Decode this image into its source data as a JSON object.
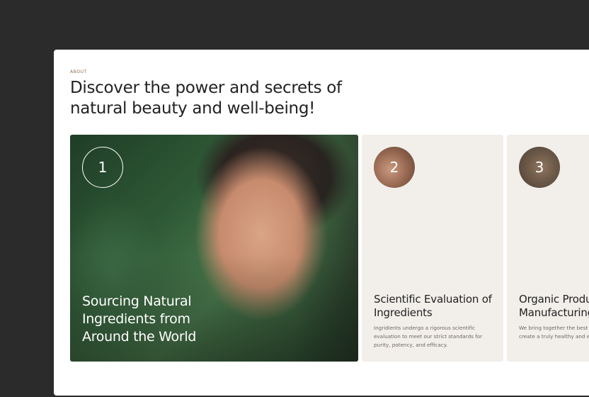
{
  "section": {
    "eyebrow": "ABOUT",
    "headline": "Discover the power and secrets of natural beauty and well-being!"
  },
  "cards": [
    {
      "number": "1",
      "title": "Sourcing Natural Ingredients from Around the World",
      "image": "portrait-photo"
    },
    {
      "number": "2",
      "title": "Scientific Evaluation of Ingredients",
      "description": "Ingridients undergo a rigorous scientific evaluation to meet our strict standards for purity, potency, and efficacy.",
      "image": "face-thumbnail"
    },
    {
      "number": "3",
      "title": "Organic Product Manufacturing",
      "description": "We bring together the best of nature and science to create a truly healthy and effective product.",
      "image": "hand-bottle-thumbnail"
    }
  ],
  "colors": {
    "background": "#2b2b2b",
    "panel": "#ffffff",
    "card": "#f2efeb",
    "eyebrow": "#8a6a52"
  }
}
